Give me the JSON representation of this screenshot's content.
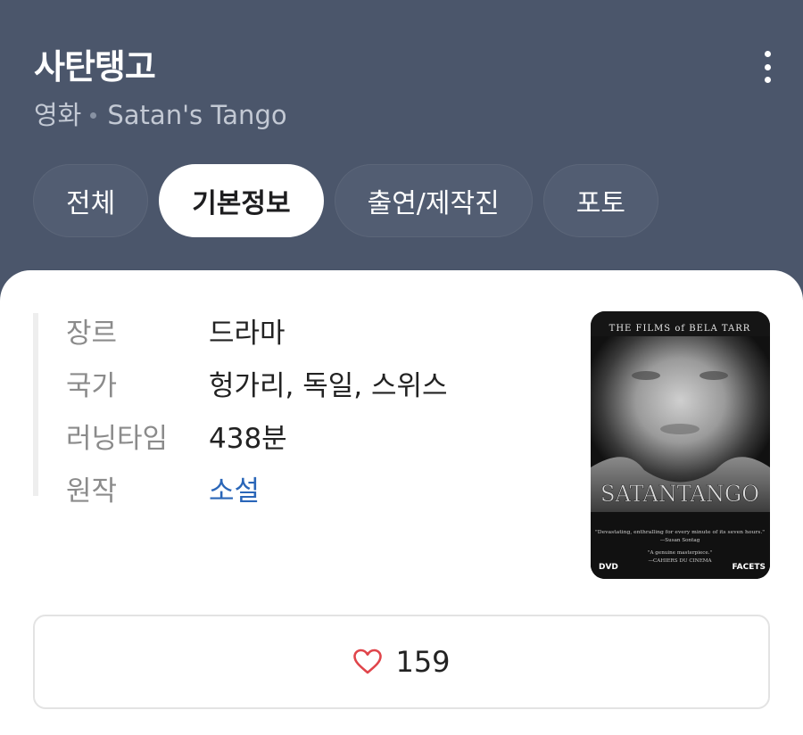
{
  "header": {
    "title": "사탄탱고",
    "category": "영화",
    "original_title": "Satan's Tango",
    "more_icon": "more-vertical-icon"
  },
  "tabs": [
    {
      "label": "전체",
      "active": false
    },
    {
      "label": "기본정보",
      "active": true
    },
    {
      "label": "출연/제작진",
      "active": false
    },
    {
      "label": "포토",
      "active": false
    }
  ],
  "info": {
    "rows": [
      {
        "label": "장르",
        "value": "드라마"
      },
      {
        "label": "국가",
        "value": "헝가리, 독일, 스위스"
      },
      {
        "label": "러닝타임",
        "value": "438분"
      },
      {
        "label": "원작",
        "value": "소설"
      }
    ]
  },
  "poster": {
    "top_text": "THE FILMS of BELA TARR",
    "title_text": "SATANTANGO",
    "quote1": "\"Devastating, enthralling for every minute of its seven hours.\"",
    "quote1_author": "—Susan Sontag",
    "quote2": "\"A genuine masterpiece.\"",
    "quote2_author": "—CAHIERS DU CINEMA",
    "dvd_label": "DVD",
    "brand_label": "FACETS"
  },
  "like": {
    "icon": "heart-icon",
    "count": "159"
  },
  "colors": {
    "header_bg": "#4b566b",
    "link": "#2a66b8",
    "heart": "#e0454b"
  }
}
